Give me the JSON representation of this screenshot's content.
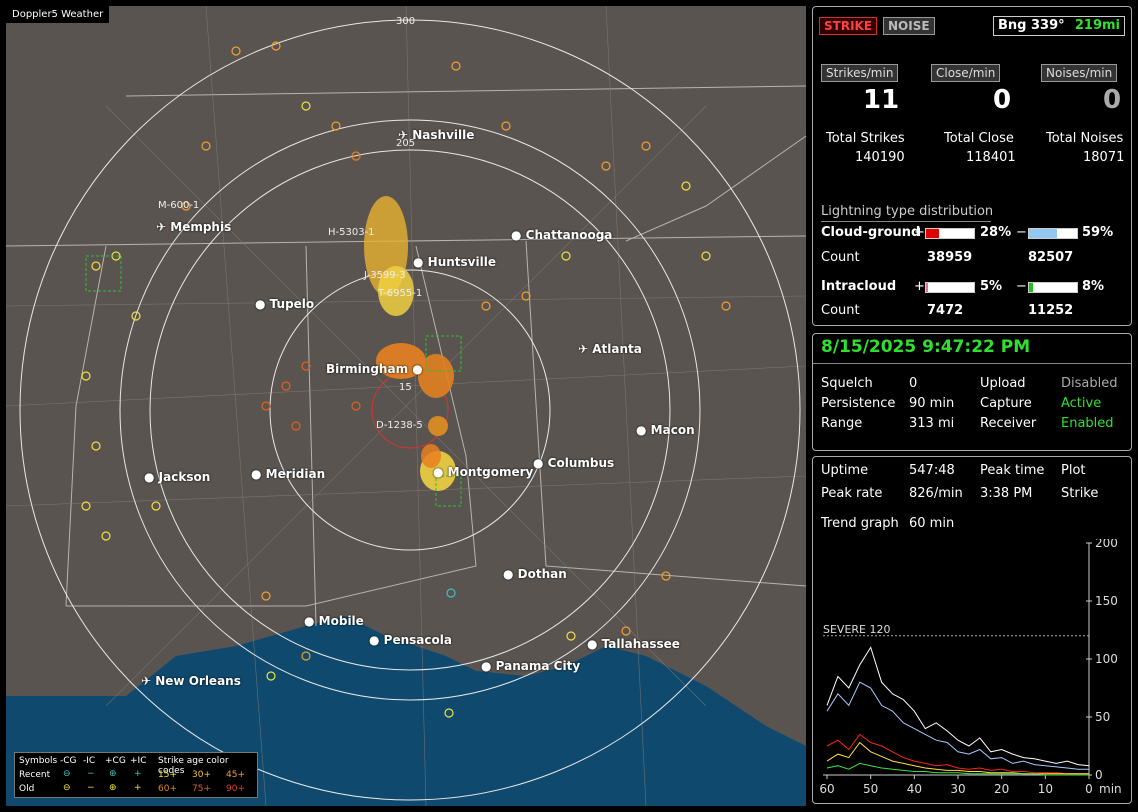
{
  "map": {
    "title": "Doppler5 Weather",
    "rings": [
      "300",
      "205",
      "15"
    ],
    "cities": [
      {
        "name": "Nashville",
        "icon": "airport-icon"
      },
      {
        "name": "Memphis",
        "icon": "airport-icon"
      },
      {
        "name": "Chattanooga",
        "icon": "city-dot-icon"
      },
      {
        "name": "Huntsville",
        "icon": "city-dot-icon"
      },
      {
        "name": "Tupelo",
        "icon": "city-dot-icon"
      },
      {
        "name": "Atlanta",
        "icon": "airport-icon"
      },
      {
        "name": "Birmingham",
        "icon": "city-dot-icon"
      },
      {
        "name": "Macon",
        "icon": "city-dot-icon"
      },
      {
        "name": "Jackson",
        "icon": "city-dot-icon"
      },
      {
        "name": "Meridian",
        "icon": "city-dot-icon"
      },
      {
        "name": "Montgomery",
        "icon": "city-dot-icon"
      },
      {
        "name": "Columbus",
        "icon": "city-dot-icon"
      },
      {
        "name": "Dothan",
        "icon": "city-dot-icon"
      },
      {
        "name": "Mobile",
        "icon": "city-dot-icon"
      },
      {
        "name": "Pensacola",
        "icon": "city-dot-icon"
      },
      {
        "name": "Tallahassee",
        "icon": "city-dot-icon"
      },
      {
        "name": "Panama City",
        "icon": "city-dot-icon"
      },
      {
        "name": "New Orleans",
        "icon": "airport-icon"
      }
    ],
    "storm_labels": [
      "M-600-1",
      "H-5303-1",
      "J-3599-3",
      "T-6955-1",
      "D-1238-5"
    ],
    "legend": {
      "symbols": "Symbols",
      "cols": [
        "-CG",
        "-IC",
        "+CG",
        "+IC"
      ],
      "recent": "Recent",
      "old": "Old",
      "age_title": "Strike age color codes",
      "ages_row1": [
        "15+",
        "30+",
        "45+"
      ],
      "ages_row2": [
        "60+",
        "75+",
        "90+"
      ]
    }
  },
  "top": {
    "strike": "STRIKE",
    "noise": "NOISE",
    "bearing": "Bng 339°",
    "distance": "219mi"
  },
  "rates": {
    "strikes_label": "Strikes/min",
    "close_label": "Close/min",
    "noises_label": "Noises/min",
    "strikes": "11",
    "close": "0",
    "noises": "0"
  },
  "totals": {
    "strikes_label": "Total Strikes",
    "close_label": "Total Close",
    "noises_label": "Total Noises",
    "strikes": "140190",
    "close": "118401",
    "noises": "18071"
  },
  "distribution": {
    "title": "Lightning type distribution",
    "cg_label": "Cloud-ground",
    "cg_pos_pct": "28%",
    "cg_neg_pct": "59%",
    "cg_pos_frac": 0.28,
    "cg_neg_frac": 0.59,
    "count_label": "Count",
    "cg_pos_count": "38959",
    "cg_neg_count": "82507",
    "ic_label": "Intracloud",
    "ic_pos_pct": "5%",
    "ic_neg_pct": "8%",
    "ic_pos_frac": 0.05,
    "ic_neg_frac": 0.08,
    "ic_pos_count": "7472",
    "ic_neg_count": "11252",
    "plus": "+",
    "minus": "−"
  },
  "status": {
    "datetime": "8/15/2025 9:47:22 PM",
    "squelch_label": "Squelch",
    "squelch": "0",
    "upload_label": "Upload",
    "upload": "Disabled",
    "persistence_label": "Persistence",
    "persistence": "90 min",
    "capture_label": "Capture",
    "capture": "Active",
    "range_label": "Range",
    "range": "313 mi",
    "receiver_label": "Receiver",
    "receiver": "Enabled"
  },
  "stats": {
    "uptime_label": "Uptime",
    "uptime": "547:48",
    "peak_time_label": "Peak time",
    "plot_label": "Plot",
    "peak_rate_label": "Peak rate",
    "peak_rate": "826/min",
    "peak_time": "3:38 PM",
    "plot": "Strike",
    "trend_label": "Trend graph",
    "trend": "60 min"
  },
  "chart_data": {
    "type": "line",
    "ylim": [
      0,
      200
    ],
    "yticks": [
      "200",
      "150",
      "100",
      "50",
      "0"
    ],
    "xticks": [
      "60",
      "50",
      "40",
      "30",
      "20",
      "10",
      "0"
    ],
    "xunit": "min",
    "threshold": {
      "label": "SEVERE 120",
      "value": 120
    },
    "series": [
      {
        "color": "#ffffff",
        "values": [
          60,
          85,
          75,
          95,
          110,
          80,
          70,
          65,
          55,
          40,
          45,
          38,
          30,
          25,
          32,
          20,
          22,
          18,
          15,
          14,
          12,
          10,
          12,
          9,
          8
        ]
      },
      {
        "color": "#a8c8ff",
        "values": [
          55,
          70,
          60,
          80,
          75,
          60,
          55,
          45,
          40,
          35,
          30,
          28,
          20,
          18,
          22,
          14,
          15,
          10,
          12,
          9,
          8,
          7,
          6,
          5,
          5
        ]
      },
      {
        "color": "#ff2020",
        "values": [
          25,
          30,
          22,
          35,
          28,
          25,
          20,
          15,
          12,
          10,
          8,
          9,
          6,
          5,
          6,
          4,
          5,
          3,
          3,
          2,
          2,
          2,
          1,
          1,
          1
        ]
      },
      {
        "color": "#ffe040",
        "values": [
          12,
          18,
          15,
          28,
          20,
          16,
          12,
          10,
          8,
          6,
          5,
          4,
          4,
          3,
          3,
          2,
          2,
          2,
          1,
          1,
          1,
          1,
          1,
          1,
          1
        ]
      },
      {
        "color": "#40e040",
        "values": [
          6,
          8,
          5,
          10,
          8,
          6,
          5,
          4,
          3,
          3,
          2,
          2,
          2,
          1,
          1,
          1,
          1,
          1,
          1,
          1,
          0,
          0,
          0,
          0,
          0
        ]
      }
    ]
  }
}
